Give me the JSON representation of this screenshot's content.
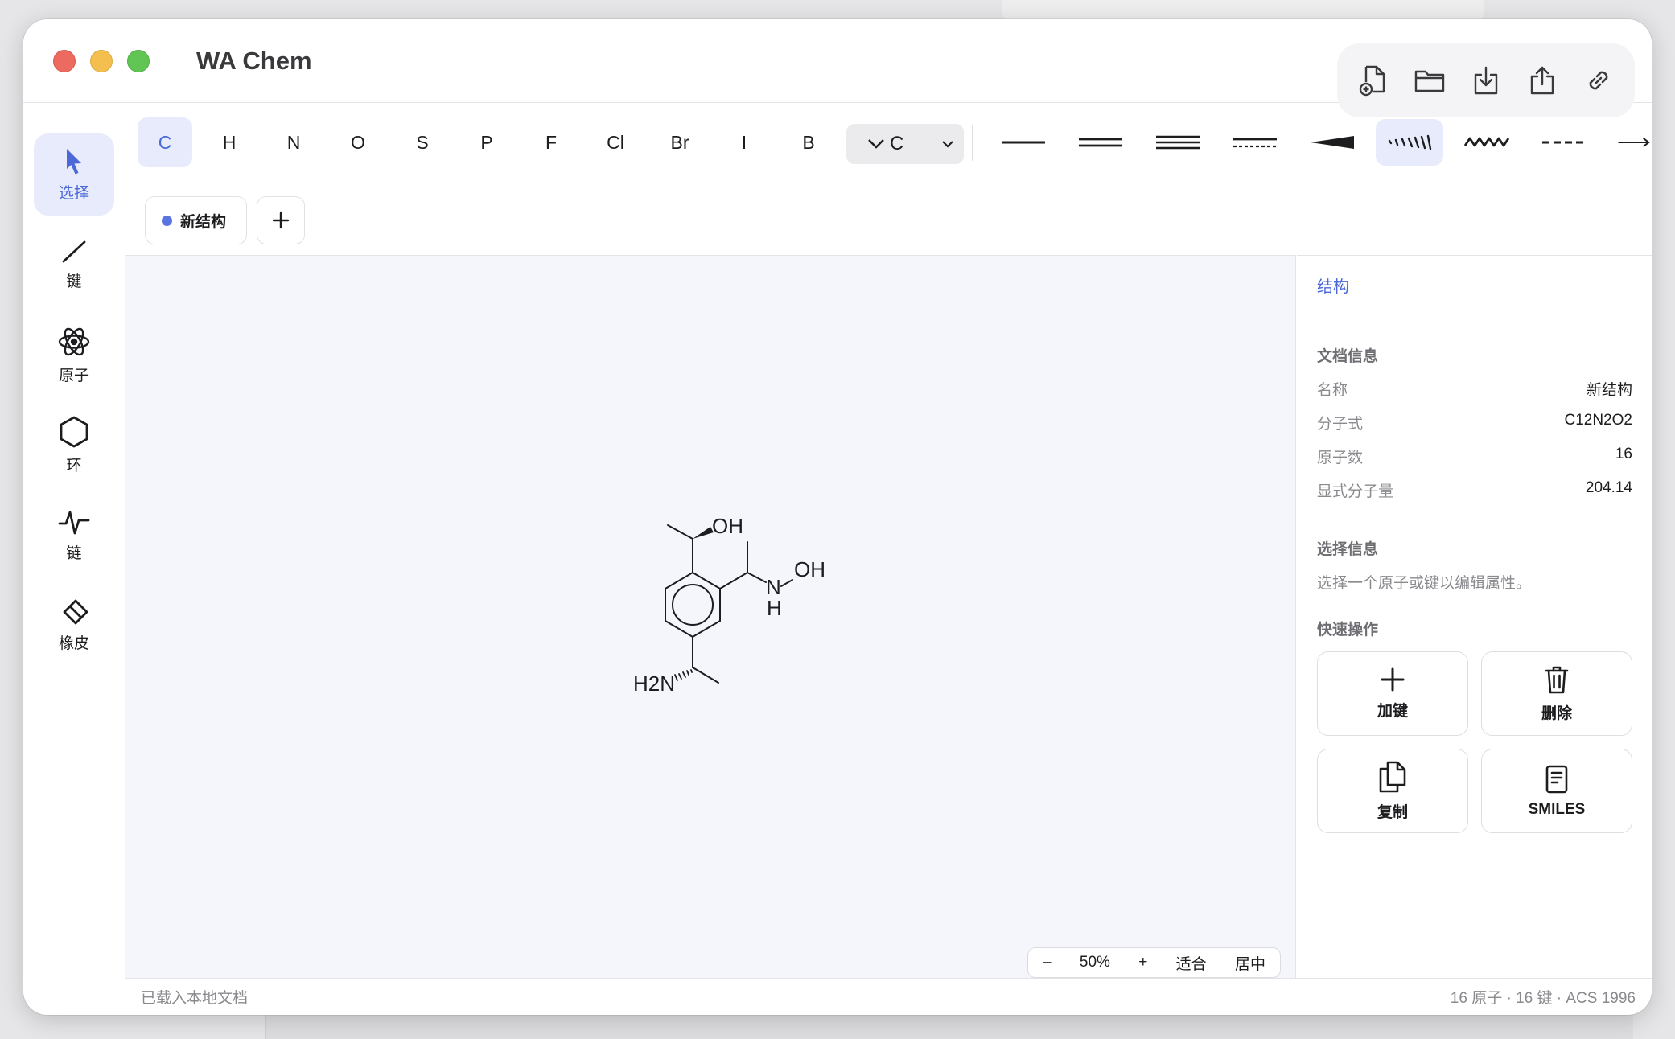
{
  "window": {
    "title": "WA Chem"
  },
  "title_actions": [
    {
      "name": "new-document-icon"
    },
    {
      "name": "folder-icon"
    },
    {
      "name": "download-icon"
    },
    {
      "name": "share-icon"
    },
    {
      "name": "link-icon"
    }
  ],
  "tools": [
    {
      "id": "select",
      "label": "选择",
      "icon": "cursor-icon",
      "active": true
    },
    {
      "id": "bond",
      "label": "键",
      "icon": "bond-line-icon"
    },
    {
      "id": "atom",
      "label": "原子",
      "icon": "atom-icon"
    },
    {
      "id": "ring",
      "label": "环",
      "icon": "hexagon-icon"
    },
    {
      "id": "chain",
      "label": "链",
      "icon": "zigzag-chain-icon"
    },
    {
      "id": "eraser",
      "label": "橡皮",
      "icon": "eraser-icon"
    }
  ],
  "elements": [
    "C",
    "H",
    "N",
    "O",
    "S",
    "P",
    "F",
    "Cl",
    "Br",
    "I",
    "B"
  ],
  "active_element": "C",
  "element_select": {
    "value": "C"
  },
  "bond_types": [
    "single",
    "double",
    "triple",
    "aromatic",
    "wedge",
    "hash",
    "wavy",
    "dashed",
    "arrow"
  ],
  "active_bond": "hash",
  "tabs": {
    "current": "新结构",
    "add_icon": "plus-icon"
  },
  "molecule": {
    "labels": {
      "oh_top": "OH",
      "oh_side": "OH",
      "n": "N",
      "h": "H",
      "h2n": "H2N"
    }
  },
  "zoom": {
    "minus": "–",
    "level": "50%",
    "plus": "+",
    "fit": "适合",
    "center": "居中"
  },
  "inspector": {
    "tab": "结构",
    "doc_info": {
      "title": "文档信息",
      "rows": [
        {
          "key": "名称",
          "value": "新结构"
        },
        {
          "key": "分子式",
          "value": "C12N2O2"
        },
        {
          "key": "原子数",
          "value": "16"
        },
        {
          "key": "显式分子量",
          "value": "204.14"
        }
      ]
    },
    "selection": {
      "title": "选择信息",
      "hint": "选择一个原子或键以编辑属性。"
    },
    "quick": {
      "title": "快速操作",
      "buttons": [
        {
          "label": "加键",
          "icon": "plus-icon"
        },
        {
          "label": "删除",
          "icon": "trash-icon"
        },
        {
          "label": "复制",
          "icon": "copy-icon"
        },
        {
          "label": "SMILES",
          "icon": "document-icon"
        }
      ]
    }
  },
  "status": {
    "left": "已载入本地文档",
    "right": "16 原子 · 16 键 · ACS 1996"
  },
  "colors": {
    "accent": "#4a68d8",
    "accent_bg": "#e7ebfb",
    "canvas": "#f4f6fb"
  }
}
